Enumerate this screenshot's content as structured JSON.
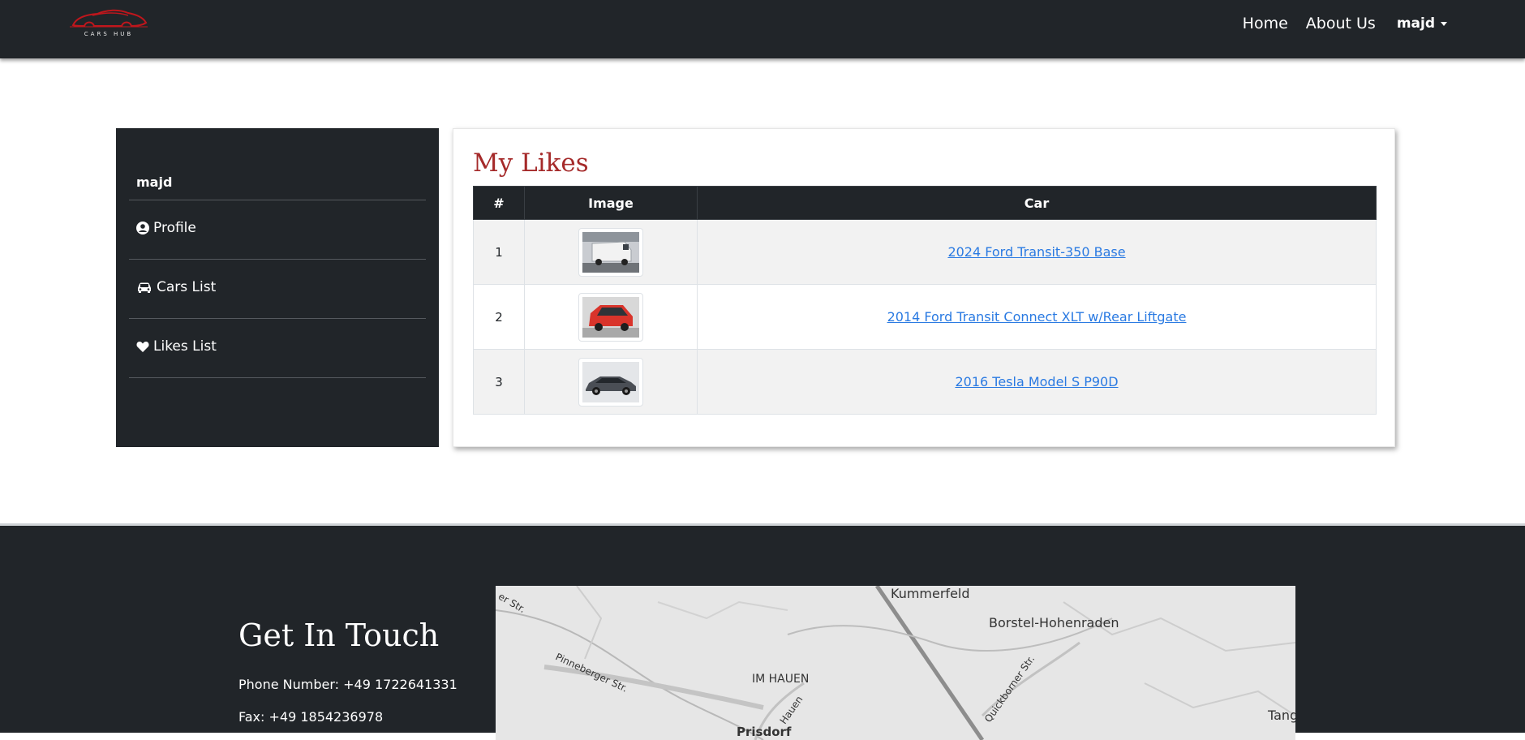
{
  "navbar": {
    "brand": "CARS HUB",
    "links": [
      "Home",
      "About Us"
    ],
    "user": "majd"
  },
  "sidebar": {
    "username": "majd",
    "items": [
      {
        "label": "Profile",
        "icon": "user-circle-icon"
      },
      {
        "label": "Cars List",
        "icon": "car-icon"
      },
      {
        "label": "Likes List",
        "icon": "heart-icon"
      }
    ]
  },
  "likes": {
    "title": "My Likes",
    "headers": [
      "#",
      "Image",
      "Car"
    ],
    "rows": [
      {
        "num": "1",
        "car": "2024 Ford Transit-350 Base",
        "image": "white-van"
      },
      {
        "num": "2",
        "car": "2014 Ford Transit Connect XLT w/Rear Liftgate",
        "image": "red-van"
      },
      {
        "num": "3",
        "car": "2016 Tesla Model S P90D",
        "image": "gray-sedan"
      }
    ]
  },
  "footer": {
    "title": "Get In Touch",
    "phone": "Phone Number:  +49 1722641331",
    "fax": "Fax:   +49 1854236978",
    "map_labels": [
      "Kummerfeld",
      "Borstel-Hohenraden",
      "IM HAUEN",
      "Pinneberger Str.",
      "Hauen",
      "Quickborner Str.",
      "Prisdorf",
      "Tang",
      "er Str."
    ]
  },
  "colors": {
    "navbar_bg": "#212529",
    "accent_title": "#a52a2a",
    "link": "#2a7ae2",
    "sidebar_bg": "#212529"
  }
}
